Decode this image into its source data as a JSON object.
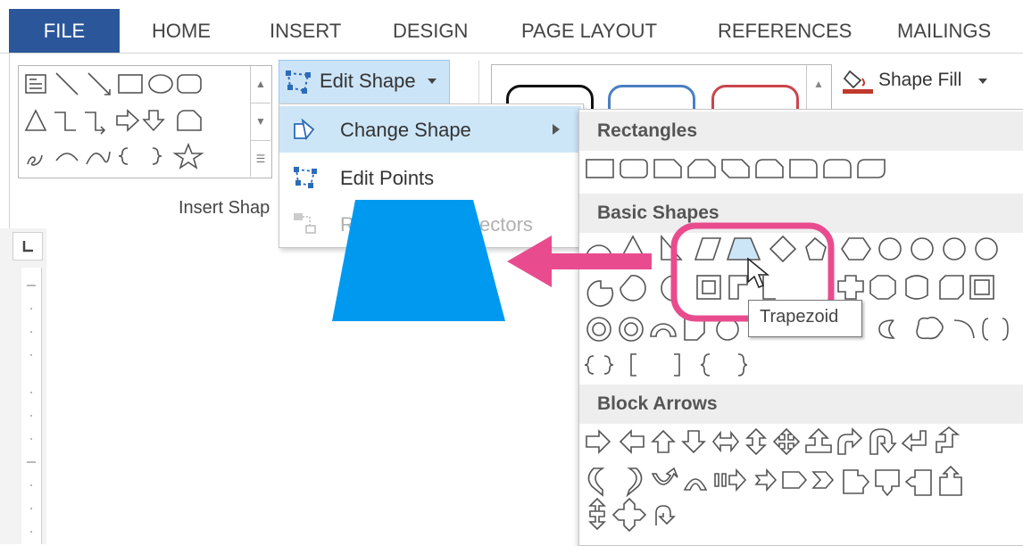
{
  "ribbon": {
    "tabs": [
      "FILE",
      "HOME",
      "INSERT",
      "DESIGN",
      "PAGE LAYOUT",
      "REFERENCES",
      "MAILINGS"
    ],
    "active_tab": "FILE",
    "insert_shapes_group_label": "Insert Shap",
    "edit_shape_label": "Edit Shape",
    "shape_fill_label": "Shape Fill",
    "accent_color": "#2b579a"
  },
  "edit_shape_menu": {
    "items": [
      {
        "label": "Change Shape",
        "icon": "change-shape-icon",
        "has_submenu": true,
        "state": "hover"
      },
      {
        "label": "Edit Points",
        "icon": "edit-points-icon",
        "state": "enabled"
      },
      {
        "label_visible_start": "R",
        "label_visible_end": "ectors",
        "icon": "reroute-connectors-icon",
        "state": "disabled"
      }
    ]
  },
  "shapes_flyout": {
    "sections": [
      {
        "title": "Rectangles"
      },
      {
        "title": "Basic Shapes"
      },
      {
        "title": "Block Arrows"
      }
    ],
    "highlighted_shape": "Trapezoid"
  },
  "tooltip": {
    "text": "Trapezoid"
  },
  "annotation": {
    "highlight_color": "#e94c8e",
    "arrow_color": "#e94c8e",
    "trapezoid_fill": "#0099f0"
  }
}
